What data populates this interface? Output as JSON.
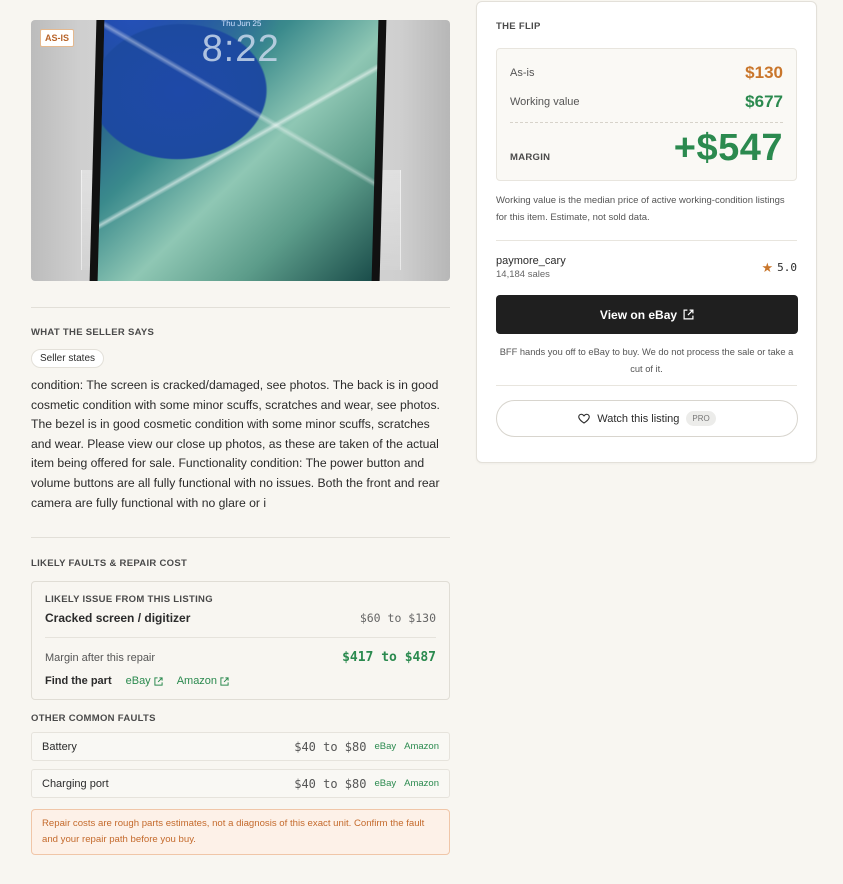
{
  "photo": {
    "badge": "AS-IS",
    "lockscreen_date": "Thu Jun 25",
    "lockscreen_time": "8:22"
  },
  "seller_section": {
    "title": "WHAT THE SELLER SAYS",
    "pill": "Seller states",
    "text": "condition: The screen is cracked/damaged, see photos. The back is in good cosmetic condition with some minor scuffs, scratches and wear, see photos. The bezel is in good cosmetic condition with some minor scuffs, scratches and wear. Please view our close up photos, as these are taken of the actual item being offered for sale. Functionality condition: The power button and volume buttons are all fully functional with no issues. Both the front and rear camera are fully functional with no glare or i"
  },
  "faults_section": {
    "title": "LIKELY FAULTS & REPAIR COST",
    "likely": {
      "label": "LIKELY ISSUE FROM THIS LISTING",
      "issue": "Cracked screen / digitizer",
      "cost": "$60 to $130",
      "margin_label": "Margin after this repair",
      "margin_value": "$417 to $487",
      "find_part_label": "Find the part",
      "link_ebay": "eBay",
      "link_amazon": "Amazon"
    },
    "other_title": "OTHER COMMON FAULTS",
    "other": [
      {
        "name": "Battery",
        "cost": "$40 to $80",
        "ebay": "eBay",
        "amazon": "Amazon"
      },
      {
        "name": "Charging port",
        "cost": "$40 to $80",
        "ebay": "eBay",
        "amazon": "Amazon"
      }
    ],
    "warning": "Repair costs are rough parts estimates, not a diagnosis of this exact unit. Confirm the fault and your repair path before you buy."
  },
  "flip": {
    "title": "THE FLIP",
    "asis_label": "As-is",
    "asis_value": "$130",
    "working_label": "Working value",
    "working_value": "$677",
    "margin_label": "MARGIN",
    "margin_value": "+$547",
    "note": "Working value is the median price of active working-condition listings for this item. Estimate, not sold data."
  },
  "seller": {
    "name": "paymore_cary",
    "sales": "14,184 sales",
    "rating": "5.0"
  },
  "actions": {
    "ebay_button": "View on eBay",
    "handoff_note": "BFF hands you off to eBay to buy. We do not process the sale or take a cut of it.",
    "watch_button": "Watch this listing",
    "pro_badge": "PRO"
  },
  "colors": {
    "green": "#2b8a4f",
    "orange": "#c9762b",
    "dark_button": "#1f1f1f"
  }
}
